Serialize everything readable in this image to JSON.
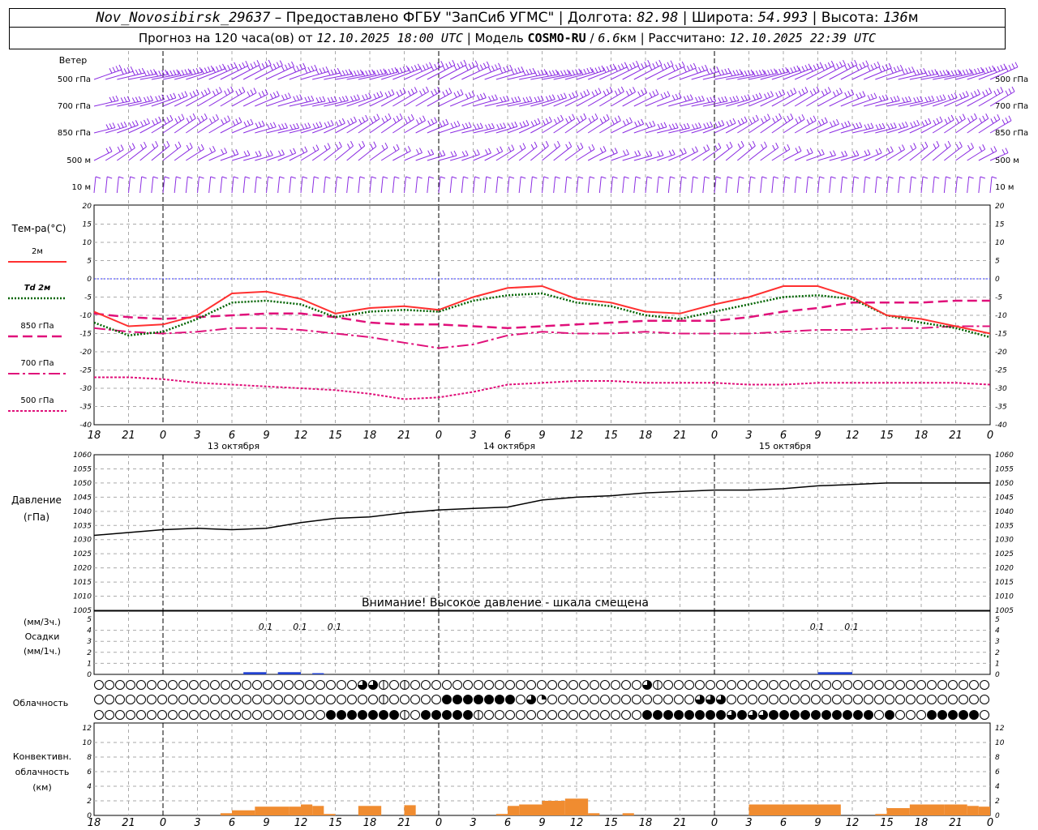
{
  "header": {
    "station": "Nov_Novosibirsk_29637",
    "provider": " – Предоставлено ФГБУ \"ЗапСиб УГМС\" | Долгота: ",
    "lon": "82.98",
    "lat_label": " | Широта: ",
    "lat": "54.993",
    "alt_label": " | Высота: ",
    "alt": "136",
    "alt_unit": "м",
    "forecast_label": "Прогноз на 120 часа(ов) от ",
    "forecast_from": "12.10.2025 18:00 UTC",
    "model_label": " | Модель ",
    "model": "COSMO-RU",
    "model_res_sep": " / ",
    "model_res": "6.6",
    "model_res_unit": "км",
    "calc_label": " | Рассчитано: ",
    "calc_time": "12.10.2025 22:39 UTC"
  },
  "colors": {
    "wind": "#8a2be2",
    "t2m": "#ff3030",
    "td2m": "#006400",
    "t850": "#e0107a",
    "t700": "#e0107a",
    "t500": "#e0107a",
    "zero_line": "#3030ff",
    "pressure": "#000000",
    "precip": "#2040d0",
    "convective": "#f08c30"
  },
  "chart_data": [
    {
      "type": "wind-barbs",
      "panel_label": "Ветер",
      "levels": [
        "500 гПа",
        "700 гПа",
        "850 гПа",
        "500 м",
        "10  м"
      ],
      "note": "barbs at each hour, strongest at 500 гПа"
    },
    {
      "type": "line",
      "ylabel": "Тем-ра(°С)",
      "ylim": [
        -40,
        20
      ],
      "yticks": [
        20,
        15,
        10,
        5,
        0,
        -5,
        -10,
        -15,
        -20,
        -25,
        -30,
        -35,
        -40
      ],
      "x_hours": [
        0,
        3,
        6,
        9,
        12,
        15,
        18,
        21,
        24,
        27,
        30,
        33,
        36,
        39,
        42,
        45,
        48,
        51,
        54,
        57,
        60,
        63,
        66,
        69,
        72,
        75,
        78
      ],
      "xtick_labels": [
        "18",
        "21",
        "0",
        "3",
        "6",
        "9",
        "12",
        "15",
        "18",
        "21",
        "0",
        "3",
        "6",
        "9",
        "12",
        "15",
        "18",
        "21",
        "0",
        "3",
        "6",
        "9",
        "12",
        "15",
        "18",
        "21",
        "0"
      ],
      "day_labels": [
        "13 октября",
        "14 октября",
        "15 октября"
      ],
      "legend": [
        "2м",
        "Td  2м",
        "850 гПа",
        "700 гПа",
        "500 гПа"
      ],
      "series": [
        {
          "name": "2м",
          "values": [
            -9,
            -13,
            -12.5,
            -10,
            -4,
            -3.5,
            -5.5,
            -9.5,
            -8,
            -7.5,
            -8.5,
            -5,
            -2.5,
            -2,
            -5.5,
            -6.5,
            -9,
            -9.5,
            -7,
            -5,
            -2,
            -2,
            -5,
            -10,
            -11,
            -13,
            -15
          ]
        },
        {
          "name": "Td  2м",
          "values": [
            -12,
            -15.5,
            -14.5,
            -11,
            -6.5,
            -6,
            -7,
            -10.5,
            -9,
            -8.5,
            -9,
            -6,
            -4.5,
            -4,
            -6.5,
            -7.5,
            -10,
            -11,
            -9,
            -7,
            -5,
            -4.5,
            -5.5,
            -10,
            -12,
            -13.5,
            -16
          ]
        },
        {
          "name": "850 гПа",
          "values": [
            -9.5,
            -10.5,
            -11,
            -10.5,
            -10,
            -9.5,
            -9.5,
            -10.5,
            -12,
            -12.5,
            -12.5,
            -13,
            -13.5,
            -13,
            -12.5,
            -12,
            -11.5,
            -11.5,
            -11.5,
            -10.5,
            -9,
            -8,
            -6.5,
            -6.5,
            -6.5,
            -6,
            -6
          ]
        },
        {
          "name": "700 гПа",
          "values": [
            -13.5,
            -14.5,
            -15,
            -14.5,
            -13.5,
            -13.5,
            -14,
            -15,
            -16,
            -17.5,
            -19,
            -18,
            -15.5,
            -14.5,
            -15,
            -15,
            -14.5,
            -15,
            -15,
            -15,
            -14.5,
            -14,
            -14,
            -13.5,
            -13.5,
            -13,
            -13
          ]
        },
        {
          "name": "500 гПа",
          "values": [
            -27,
            -27,
            -27.5,
            -28.5,
            -29,
            -29.5,
            -30,
            -30.5,
            -31.5,
            -33,
            -32.5,
            -31,
            -29,
            -28.5,
            -28,
            -28,
            -28.5,
            -28.5,
            -28.5,
            -29,
            -29,
            -28.5,
            -28.5,
            -28.5,
            -28.5,
            -28.5,
            -29
          ]
        }
      ]
    },
    {
      "type": "line",
      "ylabel": "Давление",
      "yunit": "(гПа)",
      "ylim": [
        1005,
        1060
      ],
      "yticks": [
        1060,
        1055,
        1050,
        1045,
        1040,
        1035,
        1030,
        1025,
        1020,
        1015,
        1010,
        1005
      ],
      "annotation": "Внимание! Высокое давление - шкала смещена",
      "series": [
        {
          "name": "pressure",
          "values": [
            1031.5,
            1032.5,
            1033.5,
            1034,
            1033.5,
            1034,
            1036,
            1037.5,
            1038,
            1039.5,
            1040.5,
            1041,
            1041.5,
            1044,
            1045,
            1045.5,
            1046.5,
            1047,
            1047.5,
            1047.5,
            1048,
            1049,
            1049.5,
            1050,
            1050,
            1050,
            1050
          ]
        }
      ]
    },
    {
      "type": "bar",
      "ylabel": "Осадки",
      "yunit_top": "(мм/3ч.)",
      "yunit_bottom": "(мм/1ч.)",
      "ylim": [
        0,
        5
      ],
      "yticks": [
        5,
        4,
        3,
        2,
        1,
        0
      ],
      "value_labels": [
        {
          "hour": 15,
          "text": "0.1"
        },
        {
          "hour": 18,
          "text": "0.1"
        },
        {
          "hour": 21,
          "text": "0.1"
        },
        {
          "hour": 63,
          "text": "0.1"
        },
        {
          "hour": 66,
          "text": "0.1"
        }
      ],
      "bars": [
        {
          "hour_start": 13,
          "hour_end": 15,
          "value": 0.1
        },
        {
          "hour_start": 16,
          "hour_end": 18,
          "value": 0.1
        },
        {
          "hour_start": 19,
          "hour_end": 20,
          "value": 0.05
        },
        {
          "hour_start": 63,
          "hour_end": 66,
          "value": 0.1
        }
      ]
    },
    {
      "type": "cloud-symbols",
      "label": "Облачность",
      "rows": [
        "0000000000000000000000000332020000000000000000000000320000000000000000000000000000000000000000000000000000000000000000",
        "0000000000000000000000000002000004444444031000000000000003330000000000000000000000000000000000000000000000000000000000",
        "0000000000000000000000444444420444442000000000000000444444443433444444444404000444440000000000000000000000000000000444"
      ]
    },
    {
      "type": "bar",
      "ylabel": "Конвективн. облачность (км)",
      "label_lines": [
        "Конвективн.",
        "облачность",
        "(км)"
      ],
      "ylim": [
        0,
        12
      ],
      "yticks": [
        12,
        10,
        8,
        6,
        4,
        2,
        0
      ],
      "bars": [
        {
          "hour_start": 11,
          "hour_end": 12,
          "value": 0.3
        },
        {
          "hour_start": 12,
          "hour_end": 14,
          "value": 0.7
        },
        {
          "hour_start": 14,
          "hour_end": 17,
          "value": 1.2
        },
        {
          "hour_start": 17,
          "hour_end": 18,
          "value": 1.2
        },
        {
          "hour_start": 18,
          "hour_end": 19,
          "value": 1.5
        },
        {
          "hour_start": 19,
          "hour_end": 20,
          "value": 1.3
        },
        {
          "hour_start": 20,
          "hour_end": 21,
          "value": 0.2
        },
        {
          "hour_start": 23,
          "hour_end": 25,
          "value": 1.3
        },
        {
          "hour_start": 27,
          "hour_end": 28,
          "value": 1.4
        },
        {
          "hour_start": 35,
          "hour_end": 36,
          "value": 0.2
        },
        {
          "hour_start": 36,
          "hour_end": 37,
          "value": 1.3
        },
        {
          "hour_start": 37,
          "hour_end": 39,
          "value": 1.5
        },
        {
          "hour_start": 39,
          "hour_end": 41,
          "value": 2
        },
        {
          "hour_start": 41,
          "hour_end": 43,
          "value": 2.3
        },
        {
          "hour_start": 43,
          "hour_end": 44,
          "value": 0.3
        },
        {
          "hour_start": 46,
          "hour_end": 47,
          "value": 0.3
        },
        {
          "hour_start": 57,
          "hour_end": 65,
          "value": 1.5
        },
        {
          "hour_start": 68,
          "hour_end": 69,
          "value": 0.2
        },
        {
          "hour_start": 69,
          "hour_end": 71,
          "value": 1
        },
        {
          "hour_start": 71,
          "hour_end": 74,
          "value": 1.5
        },
        {
          "hour_start": 74,
          "hour_end": 76,
          "value": 1.5
        },
        {
          "hour_start": 76,
          "hour_end": 77,
          "value": 1.3
        },
        {
          "hour_start": 77,
          "hour_end": 78,
          "value": 1.2
        }
      ]
    }
  ]
}
